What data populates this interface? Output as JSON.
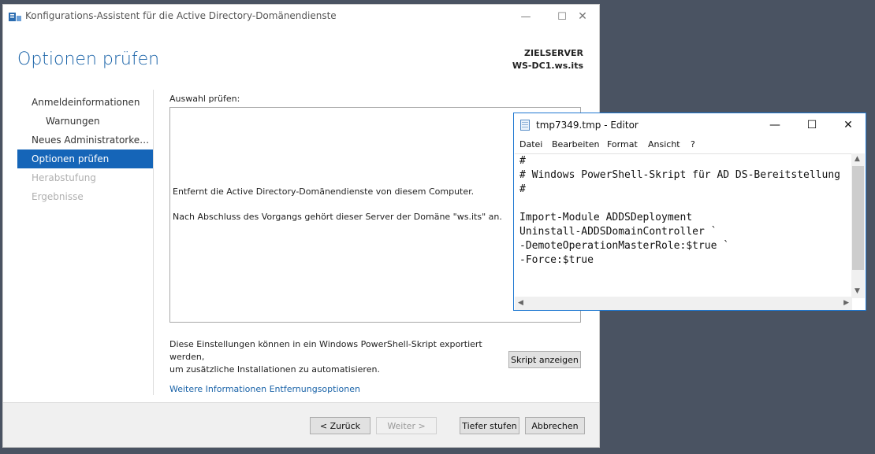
{
  "wizard": {
    "title": "Konfigurations-Assistent für die Active Directory-Domänendienste",
    "controls": {
      "minimize": "—",
      "maximize": "☐",
      "close": "✕"
    },
    "heading": "Optionen prüfen",
    "server_label": "ZIELSERVER",
    "server_name": "WS-DC1.ws.its",
    "nav": [
      {
        "label": "Anmeldeinformationen",
        "state": "normal",
        "level": 0
      },
      {
        "label": "Warnungen",
        "state": "normal",
        "level": 1
      },
      {
        "label": "Neues Administratorkenn...",
        "state": "normal",
        "level": 0
      },
      {
        "label": "Optionen prüfen",
        "state": "active",
        "level": 0
      },
      {
        "label": "Herabstufung",
        "state": "disabled",
        "level": 0
      },
      {
        "label": "Ergebnisse",
        "state": "disabled",
        "level": 0
      }
    ],
    "review_label": "Auswahl prüfen:",
    "review_lines": [
      "Entfernt die Active Directory-Domänendienste von diesem Computer.",
      "Nach Abschluss des Vorgangs gehört dieser Server der Domäne \"ws.its\" an."
    ],
    "export_line1": "Diese Einstellungen können in ein Windows PowerShell-Skript exportiert werden,",
    "export_line2": "um zusätzliche Installationen zu automatisieren.",
    "show_script_button": "Skript anzeigen",
    "more_info_link": "Weitere Informationen Entfernungsoptionen",
    "buttons": {
      "back": "< Zurück",
      "next": "Weiter >",
      "demote": "Tiefer stufen",
      "cancel": "Abbrechen"
    }
  },
  "editor": {
    "title": "tmp7349.tmp - Editor",
    "controls": {
      "minimize": "—",
      "maximize": "☐",
      "close": "✕"
    },
    "menu": [
      "Datei",
      "Bearbeiten",
      "Format",
      "Ansicht",
      "?"
    ],
    "lines": [
      "#",
      "# Windows PowerShell-Skript für AD DS-Bereitstellung",
      "#",
      "",
      "Import-Module ADDSDeployment",
      "Uninstall-ADDSDomainController `",
      "-DemoteOperationMasterRole:$true `",
      "-Force:$true"
    ]
  },
  "colors": {
    "desktop": "#4a5362",
    "accent": "#1565b8",
    "heading": "#1a63a8",
    "editor_border": "#1f78d1"
  }
}
